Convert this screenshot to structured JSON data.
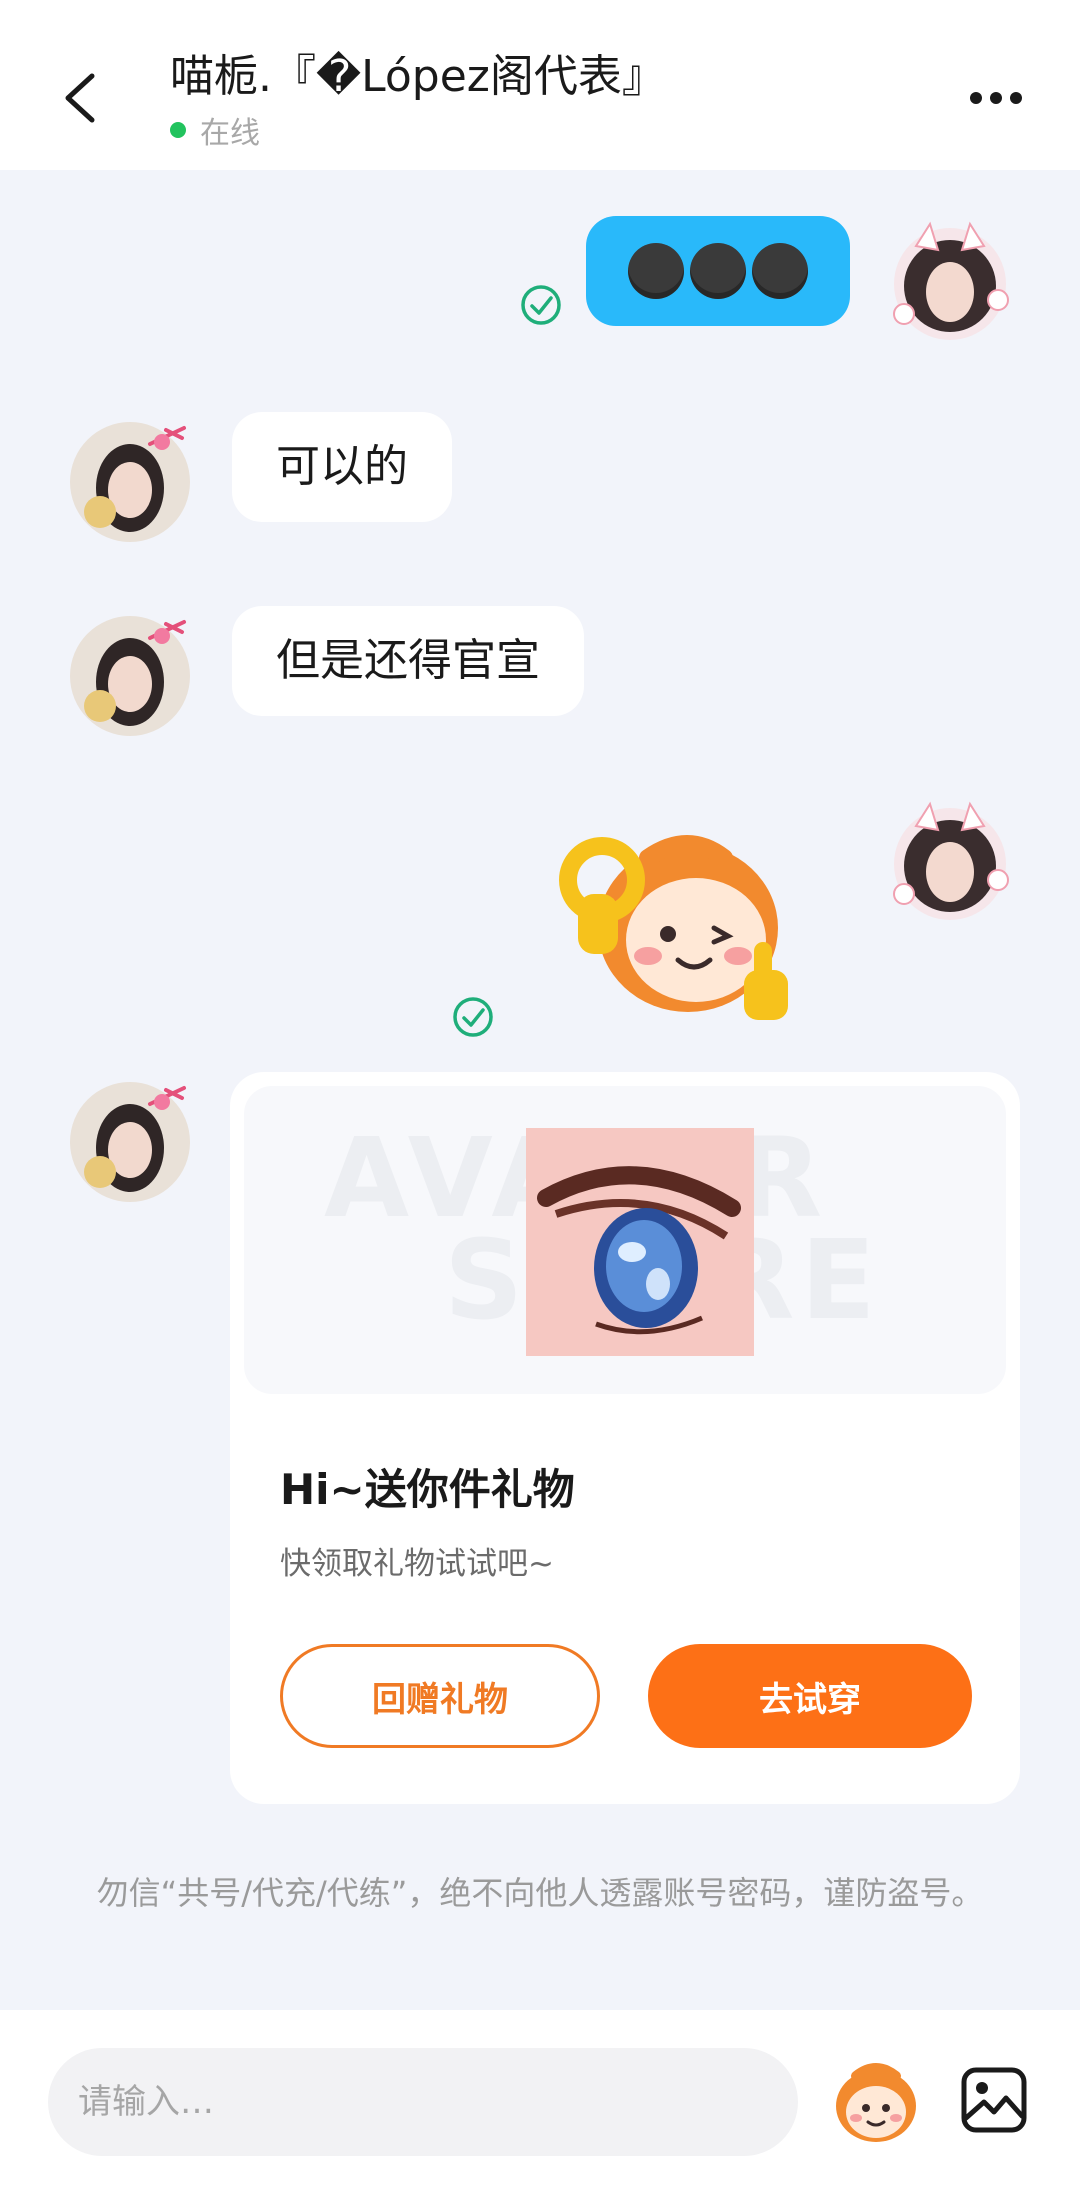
{
  "header": {
    "title": "喵栀.『�López阁代表』",
    "status": "在线",
    "status_color": "#22c35e"
  },
  "messages": [
    {
      "side": "right",
      "type": "emoji",
      "content": "smirk-face-emoji x3",
      "read": true
    },
    {
      "side": "left",
      "type": "text",
      "text": "可以的"
    },
    {
      "side": "left",
      "type": "text",
      "text": "但是还得官宣"
    },
    {
      "side": "right",
      "type": "sticker",
      "content": "ok-hand-monkey-sticker",
      "read": true
    },
    {
      "side": "left",
      "type": "gift"
    }
  ],
  "gift_card": {
    "watermark_line1": "AVATAR",
    "watermark_line2": "STORE",
    "title": "Hi~送你件礼物",
    "subtitle": "快领取礼物试试吧~",
    "return_button": "回赠礼物",
    "try_button": "去试穿",
    "accent_color": "#fd7016"
  },
  "notice": {
    "line": "勿信“共号/代充/代练”，绝不向他人透露账号密码，谨防盗号。",
    "partial": "platform notice text (partially hidden)"
  },
  "input": {
    "placeholder": "请输入…"
  },
  "icons": {
    "back": "back-arrow-icon",
    "more": "more-dots-icon",
    "read": "read-check-icon",
    "sticker": "sticker-icon",
    "image": "image-icon"
  }
}
